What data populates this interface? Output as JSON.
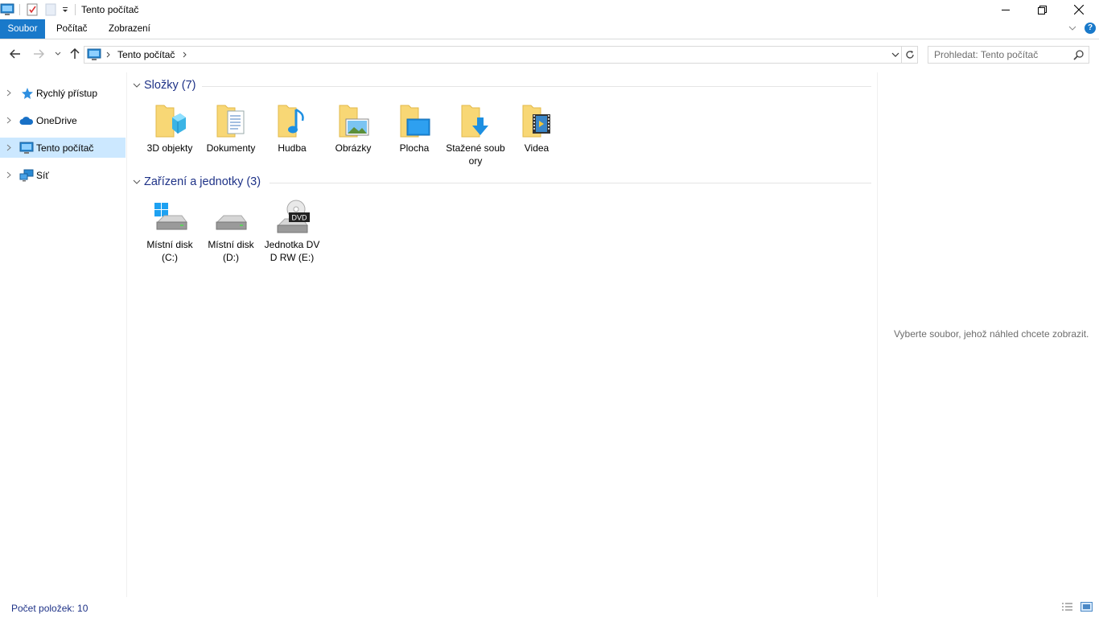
{
  "window": {
    "title": "Tento počítač"
  },
  "ribbon": {
    "tabs": [
      "Soubor",
      "Počítač",
      "Zobrazení"
    ]
  },
  "address": {
    "crumb": "Tento počítač"
  },
  "search": {
    "placeholder": "Prohledat: Tento počítač"
  },
  "navpane": {
    "items": [
      {
        "label": "Rychlý přístup",
        "icon": "star-icon"
      },
      {
        "label": "OneDrive",
        "icon": "cloud-icon"
      },
      {
        "label": "Tento počítač",
        "icon": "computer-icon",
        "selected": true
      },
      {
        "label": "Síť",
        "icon": "network-icon"
      }
    ]
  },
  "groups": {
    "folders": {
      "title": "Složky (7)",
      "items": [
        {
          "label": "3D objekty",
          "icon": "3d-objects-folder-icon"
        },
        {
          "label": "Dokumenty",
          "icon": "documents-folder-icon"
        },
        {
          "label": "Hudba",
          "icon": "music-folder-icon"
        },
        {
          "label": "Obrázky",
          "icon": "pictures-folder-icon"
        },
        {
          "label": "Plocha",
          "icon": "desktop-folder-icon"
        },
        {
          "label": "Stažené soubory",
          "icon": "downloads-folder-icon"
        },
        {
          "label": "Videa",
          "icon": "videos-folder-icon"
        }
      ]
    },
    "drives": {
      "title": "Zařízení a jednotky (3)",
      "items": [
        {
          "label": "Místní disk (C:)",
          "icon": "system-drive-icon"
        },
        {
          "label": "Místní disk (D:)",
          "icon": "drive-icon"
        },
        {
          "label": "Jednotka DVD RW (E:)",
          "icon": "dvd-drive-icon",
          "badge": "DVD"
        }
      ]
    }
  },
  "preview": {
    "text": "Vyberte soubor, jehož náhled chcete zobrazit."
  },
  "status": {
    "count": "Počet položek: 10"
  },
  "colors": {
    "accent": "#1979ca",
    "selection": "#cce8ff",
    "group_title": "#1e3287",
    "folder": "#f8d775"
  }
}
